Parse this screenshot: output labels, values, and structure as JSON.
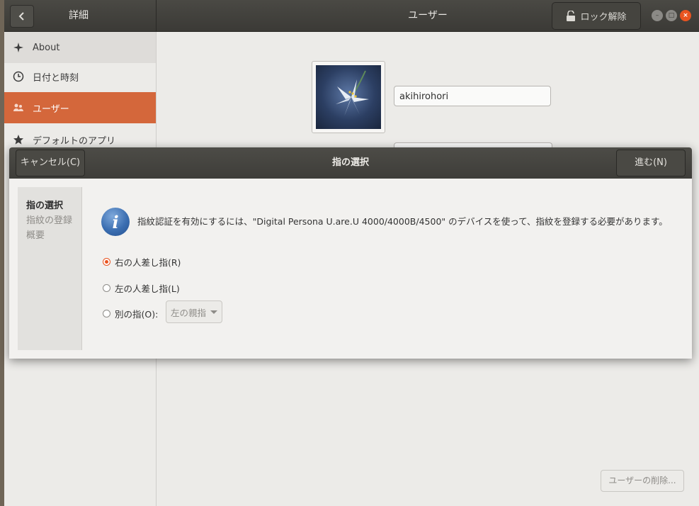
{
  "titlebar": {
    "left_title": "詳細",
    "title": "ユーザー",
    "unlock_label": "ロック解除"
  },
  "sidebar": {
    "items": [
      {
        "label": "About",
        "icon": "star-sparkle-icon"
      },
      {
        "label": "日付と時刻",
        "icon": "clock-icon"
      },
      {
        "label": "ユーザー",
        "icon": "users-icon"
      },
      {
        "label": "デフォルトのアプリ",
        "icon": "star-icon"
      }
    ]
  },
  "main": {
    "username": "akihirohori",
    "remove_user_label": "ユーザーの削除..."
  },
  "dialog": {
    "title": "指の選択",
    "cancel_label": "キャンセル(C)",
    "next_label": "進む(N)",
    "steps": [
      "指の選択",
      "指紋の登録",
      "概要"
    ],
    "info_text": "指紋認証を有効にするには、\"Digital Persona U.are.U 4000/4000B/4500\" のデバイスを使って、指紋を登録する必要があります。",
    "options": [
      {
        "label": "右の人差し指(R)",
        "checked": true
      },
      {
        "label": "左の人差し指(L)",
        "checked": false
      },
      {
        "label": "別の指(O):",
        "checked": false
      }
    ],
    "other_finger_value": "左の親指"
  },
  "colors": {
    "accent": "#e95420",
    "active_sidebar": "#d4673b",
    "titlebar": "#3e3d39"
  }
}
